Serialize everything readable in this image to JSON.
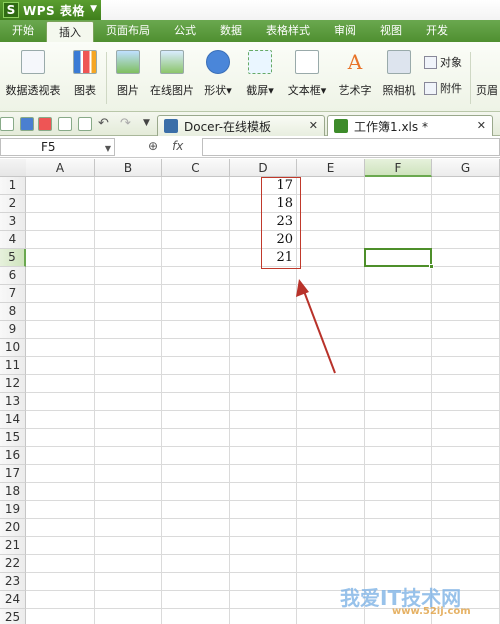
{
  "app": {
    "logo": "S",
    "title": "WPS 表格"
  },
  "menu": [
    "开始",
    "插入",
    "页面布局",
    "公式",
    "数据",
    "表格样式",
    "审阅",
    "视图",
    "开发"
  ],
  "active_menu": "插入",
  "ribbon": {
    "pivot": "数据透视表",
    "chart": "图表",
    "picture": "图片",
    "online_picture": "在线图片",
    "shape": "形状",
    "screenshot": "截屏",
    "textbox": "文本框",
    "wordart": "艺术字",
    "camera": "照相机",
    "object": "对象",
    "attachment": "附件",
    "header": "页眉"
  },
  "tabs": [
    {
      "label": "Docer-在线模板"
    },
    {
      "label": "工作簿1.xls *"
    }
  ],
  "formula_bar": {
    "name_box": "F5",
    "fx": "fx",
    "formula": ""
  },
  "columns": [
    "A",
    "B",
    "C",
    "D",
    "E",
    "F",
    "G"
  ],
  "rows": [
    "1",
    "2",
    "3",
    "4",
    "5",
    "6",
    "7",
    "8",
    "9",
    "10",
    "11",
    "12",
    "13",
    "14",
    "15",
    "16",
    "17",
    "18",
    "19",
    "20",
    "21",
    "22",
    "23",
    "24",
    "25"
  ],
  "selected_cell": "F5",
  "cells": {
    "D1": "17",
    "D2": "18",
    "D3": "23",
    "D4": "20",
    "D5": "21"
  },
  "watermark": {
    "text": "我爱IT技术网",
    "url": "www.52ij.com"
  },
  "colors": {
    "brand_green": "#4f8f30",
    "highlight_red": "#c0392b",
    "selection": "#4e8f2a"
  }
}
